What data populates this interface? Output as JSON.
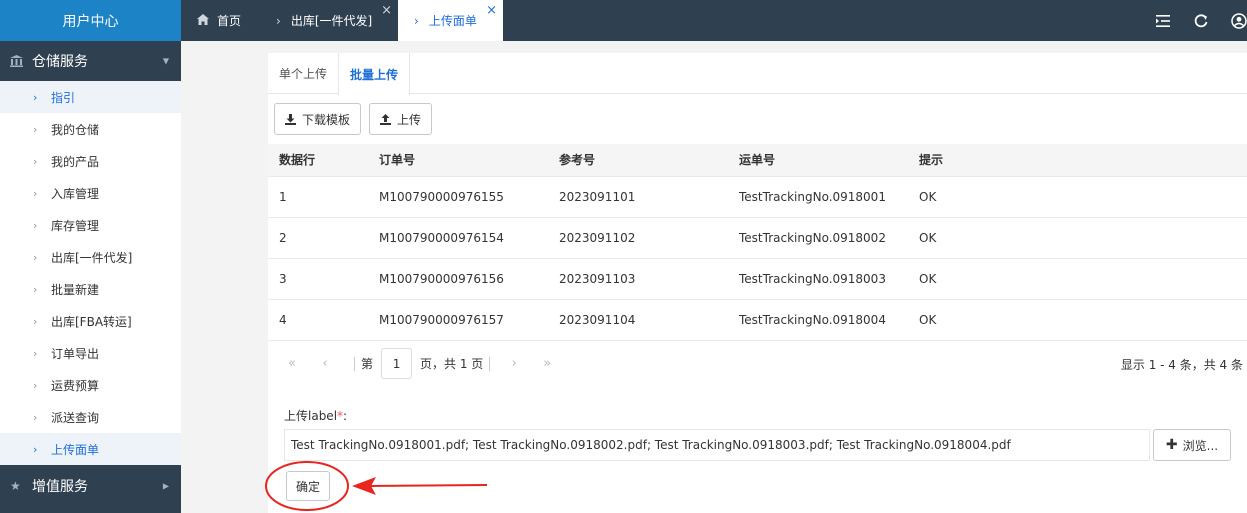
{
  "sidebar": {
    "title": "用户中心",
    "group1": {
      "icon": "bank-icon",
      "label": "仓储服务"
    },
    "items": [
      {
        "label": "指引"
      },
      {
        "label": "我的仓储"
      },
      {
        "label": "我的产品"
      },
      {
        "label": "入库管理"
      },
      {
        "label": "库存管理"
      },
      {
        "label": "出库[一件代发]"
      },
      {
        "label": "批量新建"
      },
      {
        "label": "出库[FBA转运]"
      },
      {
        "label": "订单导出"
      },
      {
        "label": "运费预算"
      },
      {
        "label": "派送查询"
      },
      {
        "label": "上传面单"
      }
    ],
    "active_item": "上传面单",
    "group2": {
      "icon": "star-icon",
      "label": "增值服务"
    }
  },
  "tabs": {
    "home": "首页",
    "tab2": "出库[一件代发]",
    "tab3": "上传面单",
    "close": "×"
  },
  "subtabs": {
    "single": "单个上传",
    "batch": "批量上传"
  },
  "buttons": {
    "download_template": "下载模板",
    "upload": "上传",
    "browse": "浏览...",
    "confirm": "确定"
  },
  "table": {
    "headers": [
      "数据行",
      "订单号",
      "参考号",
      "运单号",
      "提示"
    ],
    "rows": [
      [
        "1",
        "M100790000976155",
        "2023091101",
        "TestTrackingNo.0918001",
        "OK"
      ],
      [
        "2",
        "M100790000976154",
        "2023091102",
        "TestTrackingNo.0918002",
        "OK"
      ],
      [
        "3",
        "M100790000976156",
        "2023091103",
        "TestTrackingNo.0918003",
        "OK"
      ],
      [
        "4",
        "M100790000976157",
        "2023091104",
        "TestTrackingNo.0918004",
        "OK"
      ]
    ]
  },
  "pager": {
    "first": "«",
    "prev": "‹",
    "page_prefix": "第",
    "page_value": "1",
    "page_suffix": "页，共 1 页",
    "next": "›",
    "last": "»",
    "info": "显示 1 - 4 条，共 4 条"
  },
  "upload": {
    "label": "上传label",
    "required_mark": "*",
    "colon": ":",
    "files": "Test TrackingNo.0918001.pdf; Test TrackingNo.0918002.pdf; Test TrackingNo.0918003.pdf; Test TrackingNo.0918004.pdf"
  },
  "colors": {
    "accent": "#1e6fd9",
    "sidebar_bg": "#2f4050",
    "header_bg": "#1c84c6",
    "annotation": "#e8251f"
  }
}
